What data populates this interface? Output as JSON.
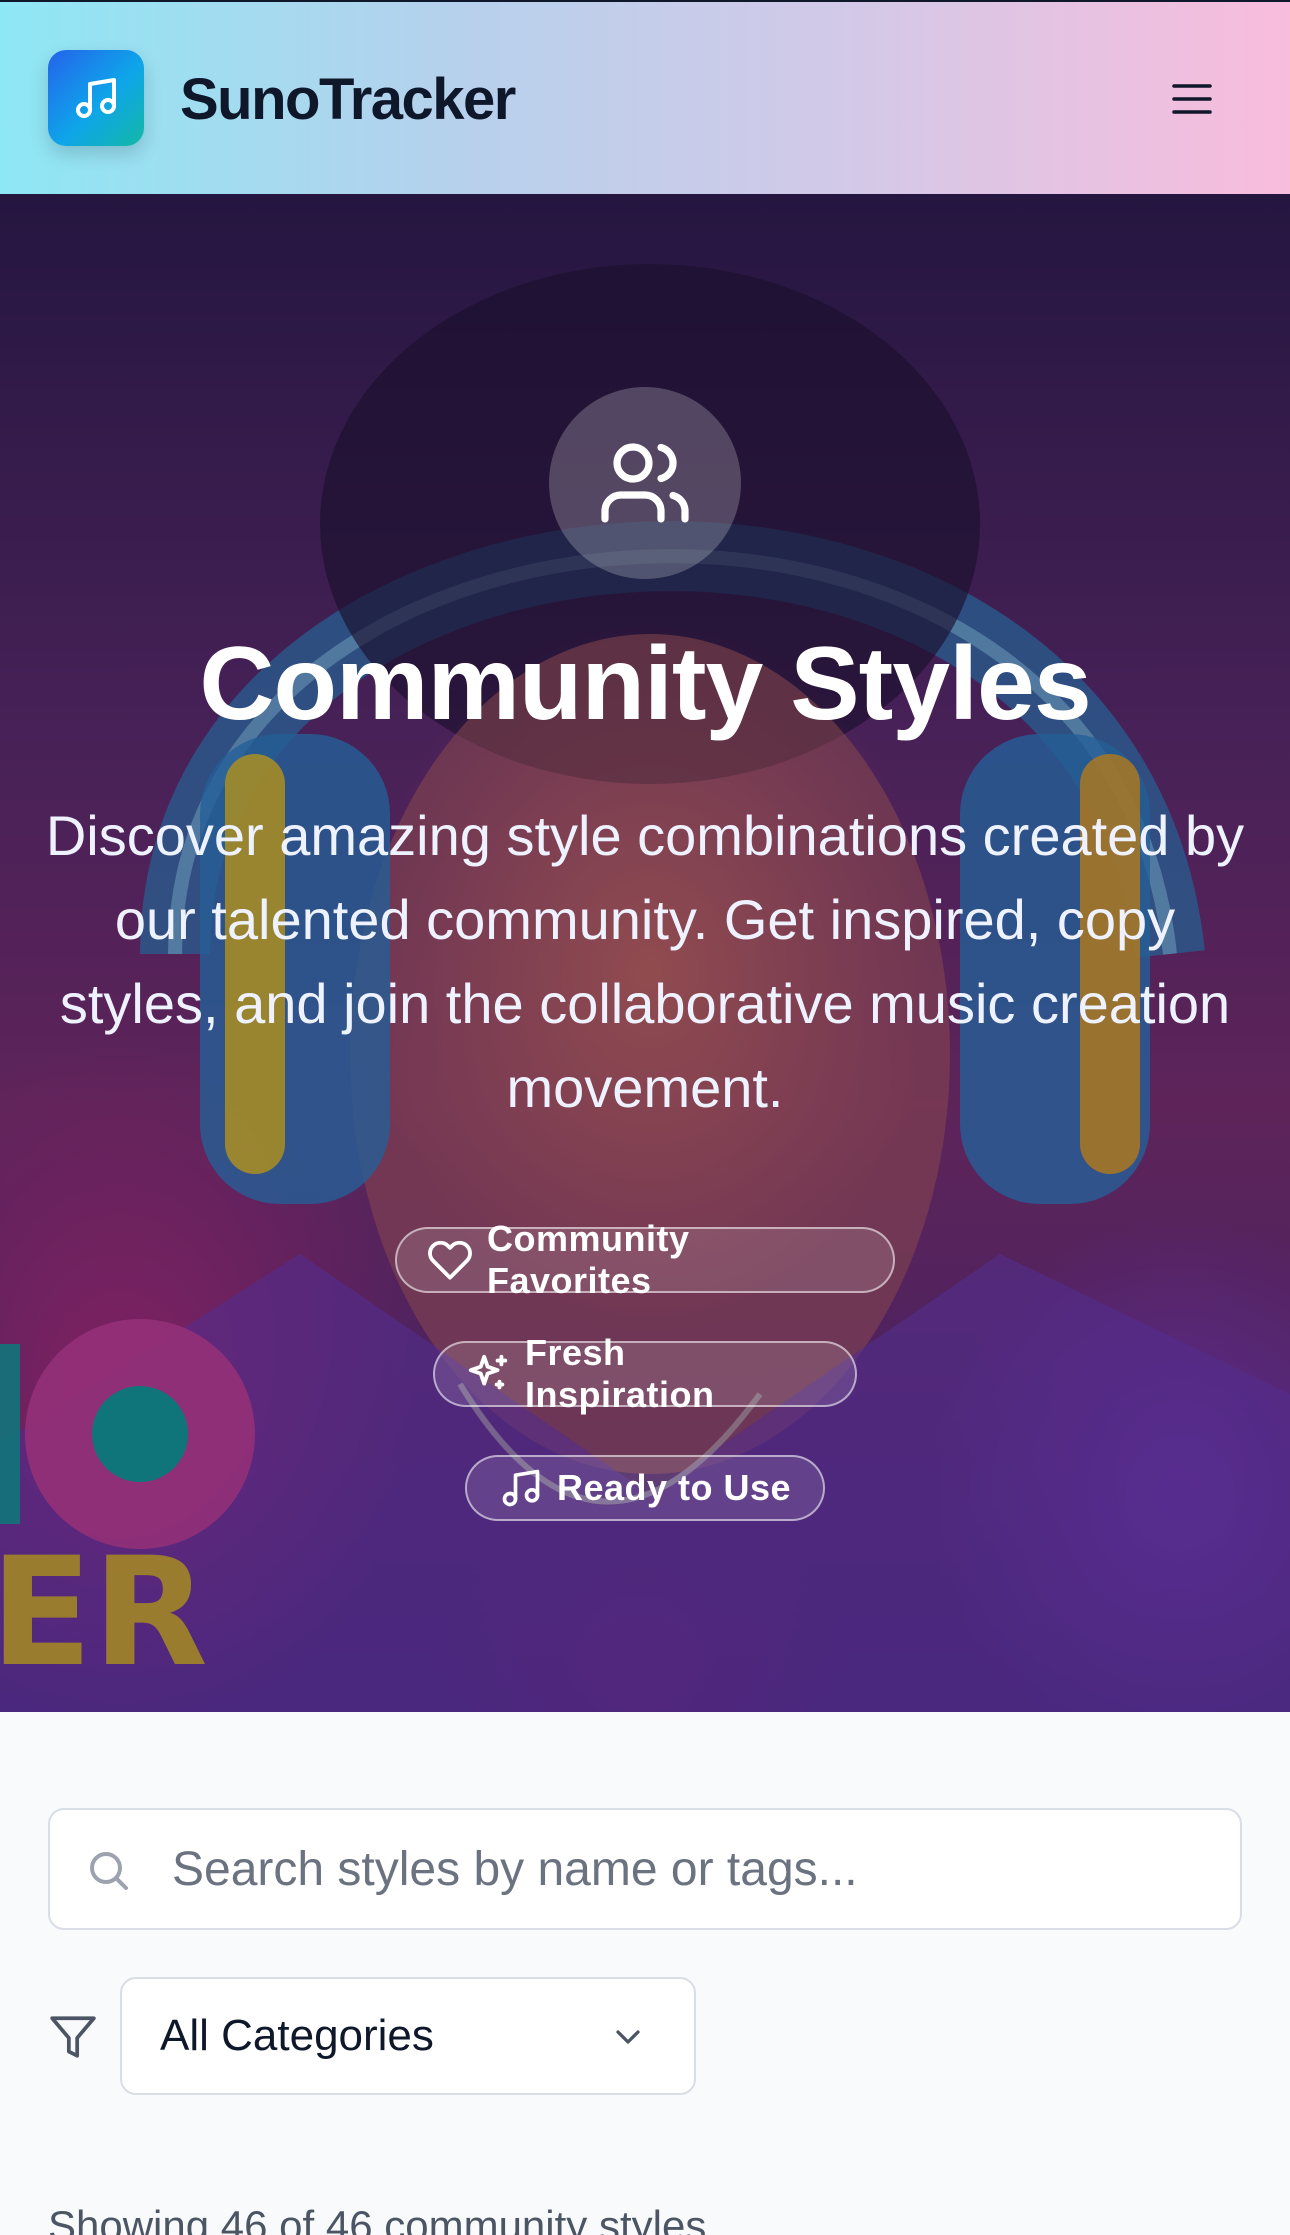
{
  "header": {
    "brand": "SunoTracker",
    "logo_icon": "music-note-icon",
    "menu_icon": "hamburger-menu-icon"
  },
  "hero": {
    "icon": "users-icon",
    "title": "Community Styles",
    "description": "Discover amazing style combinations created by our talented community. Get inspired, copy styles, and join the collaborative music creation movement.",
    "badges": [
      {
        "label": "Community Favorites",
        "icon": "heart-icon"
      },
      {
        "label": "Fresh Inspiration",
        "icon": "sparkles-icon"
      },
      {
        "label": "Ready to Use",
        "icon": "music-note-icon"
      }
    ]
  },
  "filters": {
    "search": {
      "placeholder": "Search styles by name or tags...",
      "value": ""
    },
    "category": {
      "selected": "All Categories"
    }
  },
  "results": {
    "count_text": "Showing 46 of 46 community styles"
  },
  "colors": {
    "header_gradient_start": "#8ee7f4",
    "header_gradient_end": "#f9bcdc",
    "logo_gradient_start": "#2563eb",
    "logo_gradient_end": "#14b8a6",
    "page_background": "#f8fafc",
    "text_primary": "#0f172a"
  }
}
